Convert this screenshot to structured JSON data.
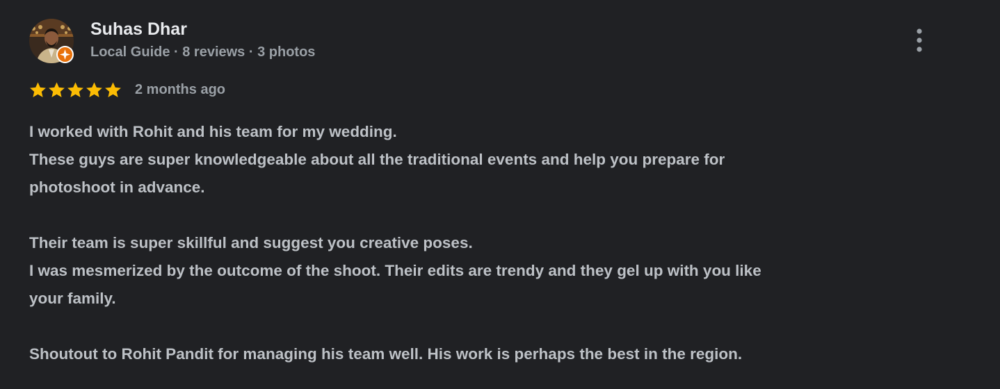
{
  "review": {
    "author_name": "Suhas Dhar",
    "author_meta": "Local Guide · 8 reviews · 3 photos",
    "rating": 5,
    "rating_max": 5,
    "date": "2 months ago",
    "text_lines": [
      "I worked with Rohit and his team for my wedding.",
      "These guys are super knowledgeable about all the traditional events and help you prepare for",
      "photoshoot in advance.",
      "",
      "Their team is super skillful and suggest you creative poses.",
      "I was mesmerized by the outcome of the shoot. Their edits are trendy and they gel up with you like",
      "your family.",
      "",
      "Shoutout to Rohit Pandit for managing his team well. His work is perhaps the best in the region."
    ],
    "star_icon": "star-icon",
    "badge_icon": "local-guide-badge-icon",
    "menu_icon": "more-vert-icon"
  },
  "colors": {
    "background": "#202124",
    "name": "#e8eaed",
    "meta": "#9aa0a6",
    "body": "#bdc1c6",
    "star": "#fbbc04",
    "badge": "#e8710a"
  }
}
